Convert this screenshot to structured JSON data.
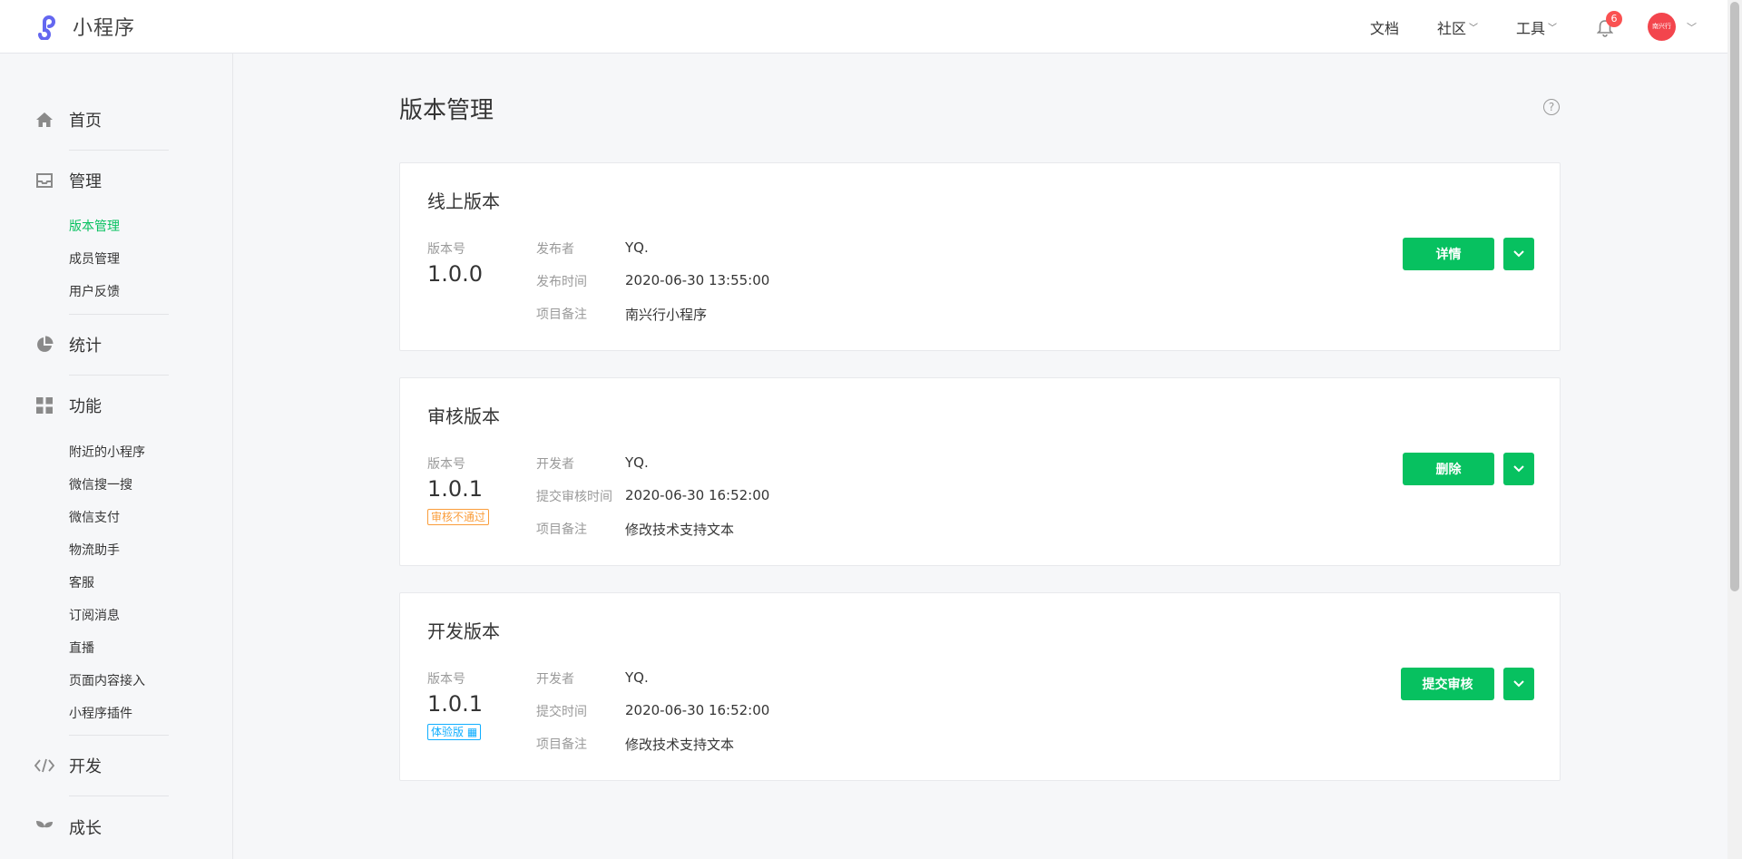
{
  "app": {
    "name": "小程序"
  },
  "topnav": {
    "docs": "文档",
    "community": "社区",
    "tools": "工具",
    "notifications": "6",
    "avatar_text": "南兴行"
  },
  "sidebar": {
    "home": "首页",
    "manage": "管理",
    "manage_items": [
      "版本管理",
      "成员管理",
      "用户反馈"
    ],
    "stats": "统计",
    "features": "功能",
    "feature_items": [
      "附近的小程序",
      "微信搜一搜",
      "微信支付",
      "物流助手",
      "客服",
      "订阅消息",
      "直播",
      "页面内容接入",
      "小程序插件"
    ],
    "develop": "开发",
    "growth": "成长"
  },
  "page": {
    "title": "版本管理",
    "help": "?"
  },
  "cards": [
    {
      "title": "线上版本",
      "version_label": "版本号",
      "version": "1.0.0",
      "tag": "",
      "rows": [
        {
          "k": "发布者",
          "v": "YQ."
        },
        {
          "k": "发布时间",
          "v": "2020-06-30 13:55:00"
        },
        {
          "k": "项目备注",
          "v": "南兴行小程序"
        }
      ],
      "button": "详情"
    },
    {
      "title": "审核版本",
      "version_label": "版本号",
      "version": "1.0.1",
      "tag": "审核不通过",
      "rows": [
        {
          "k": "开发者",
          "v": "YQ."
        },
        {
          "k": "提交审核时间",
          "v": "2020-06-30 16:52:00"
        },
        {
          "k": "项目备注",
          "v": "修改技术支持文本"
        }
      ],
      "button": "删除"
    },
    {
      "title": "开发版本",
      "version_label": "版本号",
      "version": "1.0.1",
      "tag": "体验版",
      "rows": [
        {
          "k": "开发者",
          "v": "YQ."
        },
        {
          "k": "提交时间",
          "v": "2020-06-30 16:52:00"
        },
        {
          "k": "项目备注",
          "v": "修改技术支持文本"
        }
      ],
      "button": "提交审核"
    }
  ],
  "colors": {
    "accent": "#07c160",
    "warning": "#fa9d3b",
    "info": "#10aeff",
    "badge": "#fa5151"
  }
}
